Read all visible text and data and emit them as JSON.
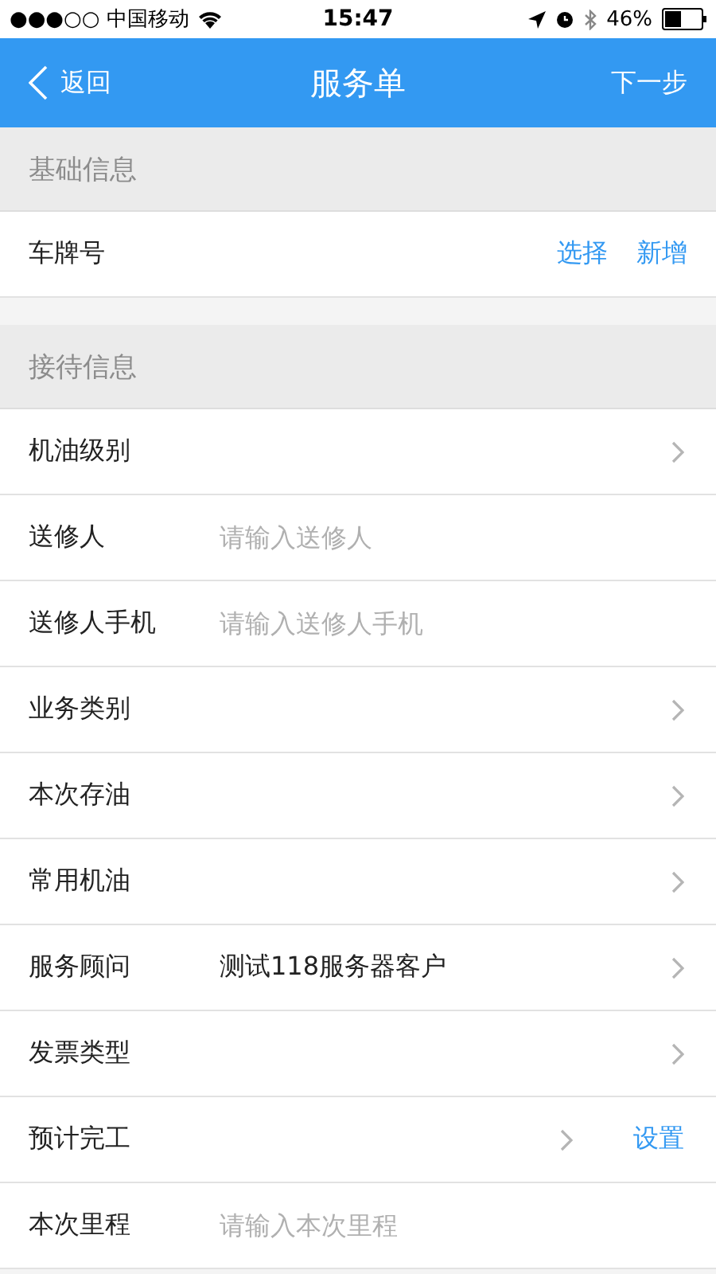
{
  "status_bar": {
    "carrier": "●●●○○ 中国移动",
    "time": "15:47",
    "battery": "46%"
  },
  "nav": {
    "back": "返回",
    "title": "服务单",
    "next": "下一步"
  },
  "sections": [
    {
      "title": "基础信息",
      "rows": [
        {
          "kind": "actions",
          "label": "车牌号",
          "actions": [
            "选择",
            "新增"
          ]
        }
      ]
    },
    {
      "title": "接待信息",
      "rows": [
        {
          "kind": "select",
          "label": "机油级别"
        },
        {
          "kind": "input",
          "label": "送修人",
          "placeholder": "请输入送修人"
        },
        {
          "kind": "input",
          "label": "送修人手机",
          "placeholder": "请输入送修人手机"
        },
        {
          "kind": "select",
          "label": "业务类别"
        },
        {
          "kind": "select",
          "label": "本次存油"
        },
        {
          "kind": "select",
          "label": "常用机油"
        },
        {
          "kind": "select",
          "label": "服务顾问",
          "value": "测试118服务器客户"
        },
        {
          "kind": "select",
          "label": "发票类型"
        },
        {
          "kind": "schedule",
          "label": "预计完工",
          "action": "设置"
        },
        {
          "kind": "input",
          "label": "本次里程",
          "placeholder": "请输入本次里程"
        }
      ]
    }
  ]
}
